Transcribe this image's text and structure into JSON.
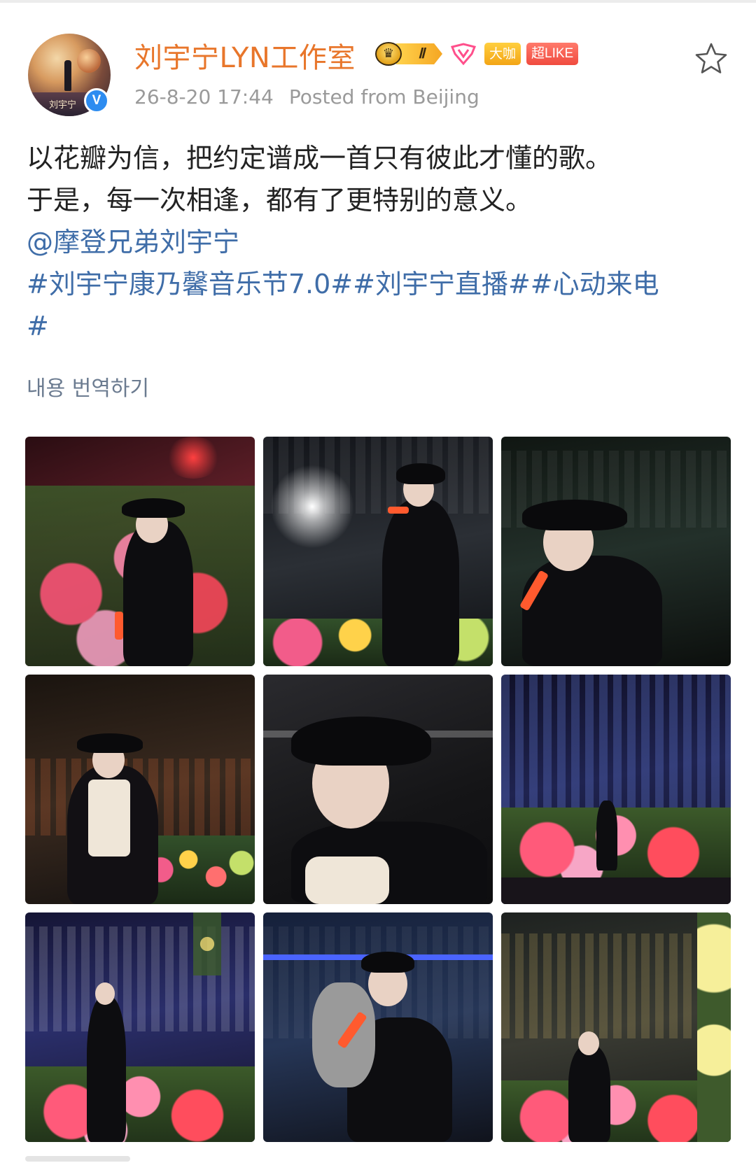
{
  "header": {
    "username": "刘宇宁LYN工作室",
    "avatar_signature": "刘宇宁",
    "verified_mark": "V",
    "badges": {
      "crown_icon": "crown-icon",
      "level": "Ⅱ",
      "pink_icon": "fan-badge-icon",
      "daka": "大咖",
      "like": "超LIKE"
    },
    "timestamp": "26-8-20 17:44",
    "location": "Posted from Beijing",
    "favorite_icon": "star-outline-icon"
  },
  "post": {
    "line1": "以花瓣为信，把约定谱成一首只有彼此才懂的歌。",
    "line2": "于是，每一次相逢，都有了更特别的意义。",
    "mention": "@摩登兄弟刘宇宁",
    "hashtags_line": "#刘宇宁康乃馨音乐节7.0##刘宇宁直播##心动来电",
    "hashtag_tail": "#",
    "translate_label": "내용 번역하기"
  },
  "photos": {
    "count": 9
  },
  "colors": {
    "username": "#e8762b",
    "link": "#3f6da8",
    "meta": "#9a9a9a",
    "verified": "#2d8cf0",
    "daka_badge": "#f3a516",
    "like_badge": "#f04b3f"
  }
}
